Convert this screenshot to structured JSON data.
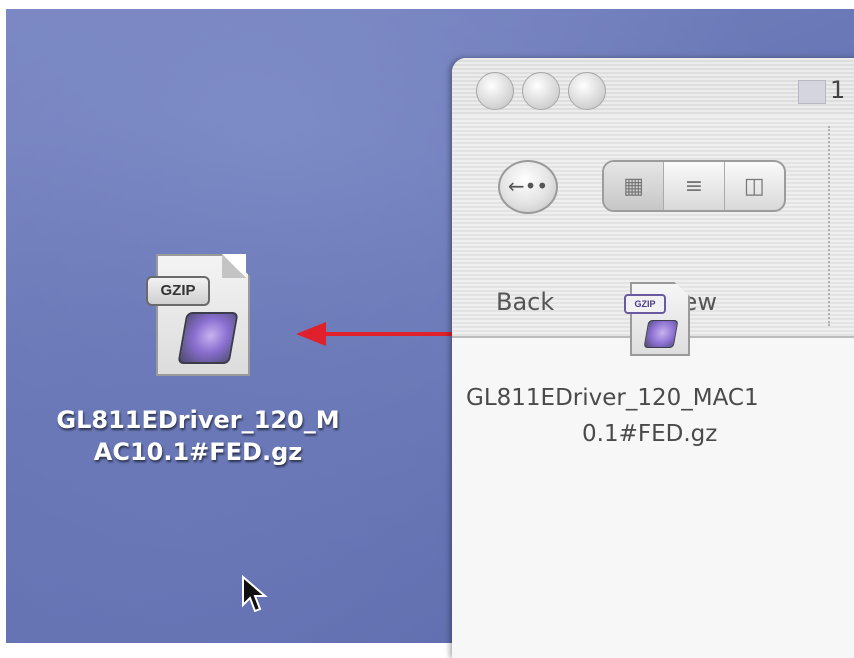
{
  "desktop": {
    "icon": {
      "badge": "GZIP",
      "label_line1": "GL811EDriver_120_M",
      "label_line2": "AC10.1#FED.gz"
    }
  },
  "window": {
    "title": "1",
    "toolbar": {
      "back_label": "Back",
      "view_label": "View",
      "view_modes": [
        "icon-view-icon",
        "list-view-icon",
        "column-view-icon"
      ]
    },
    "content": {
      "file": {
        "badge": "GZIP",
        "label_line1": "GL811EDriver_120_MAC1",
        "label_line2": "0.1#FED.gz"
      }
    }
  },
  "colors": {
    "desktop": "#6a78b8",
    "arrow": "#e0202a"
  }
}
